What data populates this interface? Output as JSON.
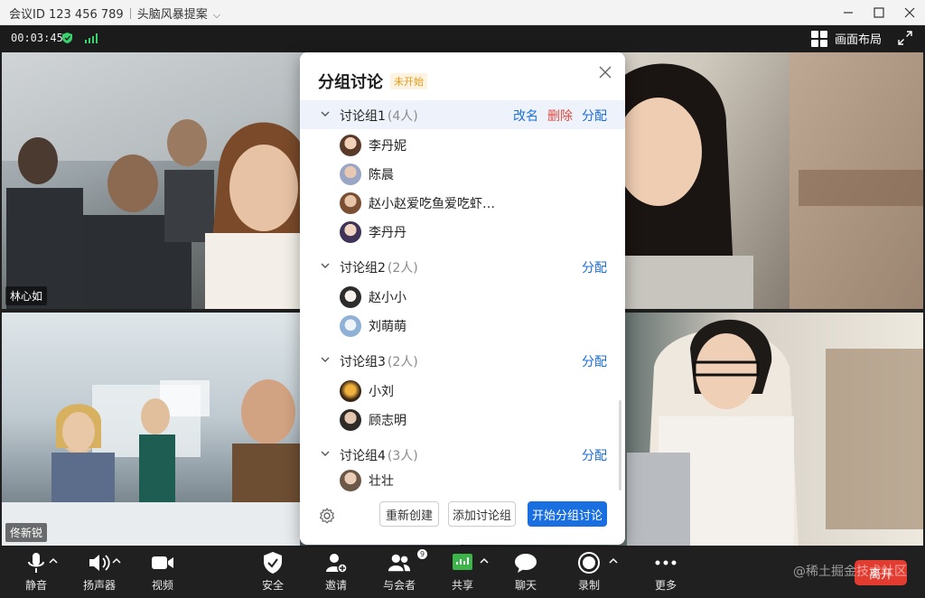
{
  "titlebar": {
    "meeting_id_label": "会议ID 123 456 789",
    "meeting_topic": "头脑风暴提案"
  },
  "status": {
    "timer": "00:03:45",
    "layout_label": "画面布局"
  },
  "videos": [
    {
      "name": "林心如"
    },
    {
      "name": ""
    },
    {
      "name": "佟新锐"
    },
    {
      "name": ""
    }
  ],
  "panel": {
    "title": "分组讨论",
    "status_badge": "未开始",
    "groups": [
      {
        "name": "讨论组1",
        "count": "(4人)",
        "actions": {
          "rename": "改名",
          "delete": "删除",
          "assign": "分配"
        },
        "members": [
          "李丹妮",
          "陈晨",
          "赵小赵爱吃鱼爱吃虾…",
          "李丹丹"
        ]
      },
      {
        "name": "讨论组2",
        "count": "(2人)",
        "actions": {
          "assign": "分配"
        },
        "members": [
          "赵小小",
          "刘萌萌"
        ]
      },
      {
        "name": "讨论组3",
        "count": "(2人)",
        "actions": {
          "assign": "分配"
        },
        "members": [
          "小刘",
          "顾志明"
        ]
      },
      {
        "name": "讨论组4",
        "count": "(3人)",
        "actions": {
          "assign": "分配"
        },
        "members": [
          "壮壮"
        ]
      }
    ],
    "footer": {
      "recreate": "重新创建",
      "add_group": "添加讨论组",
      "start": "开始分组讨论"
    }
  },
  "toolbar": {
    "mute": "静音",
    "speaker": "扬声器",
    "video": "视频",
    "security": "安全",
    "invite": "邀请",
    "participants": "与会者",
    "participants_count": "9",
    "share": "共享",
    "chat": "聊天",
    "record": "录制",
    "more": "更多",
    "leave": "离开",
    "watermark": "@稀土掘金技术社区"
  },
  "colors": {
    "accent": "#1a6fe0",
    "danger": "#e5483f",
    "badge": "#e59a1b",
    "share_green": "#3bb44a",
    "signal_green": "#3bd16f"
  }
}
